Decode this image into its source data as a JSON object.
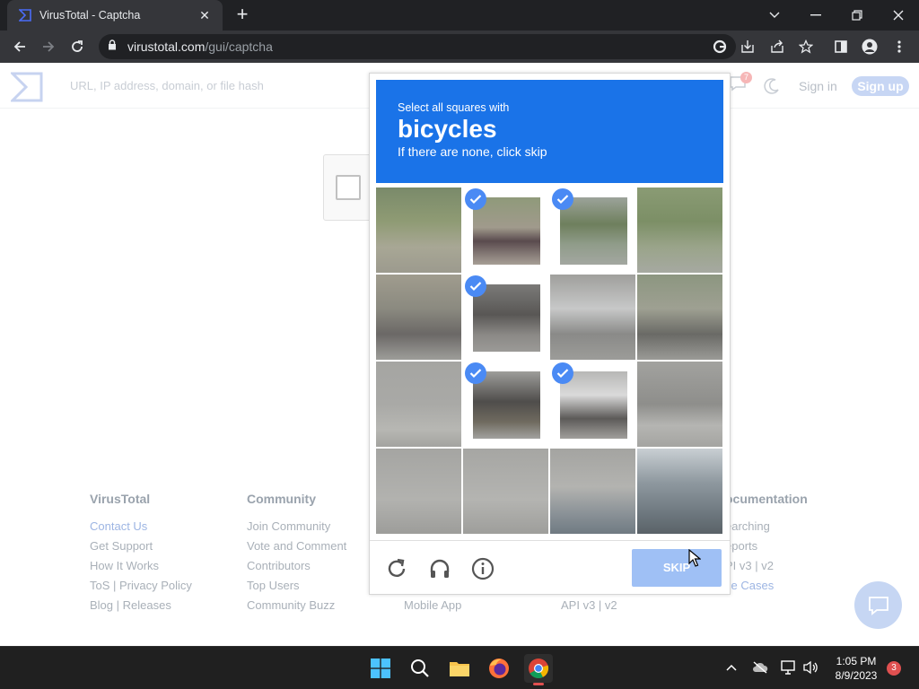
{
  "browser": {
    "tab_title": "VirusTotal - Captcha",
    "url_host": "virustotal.com",
    "url_path": "/gui/captcha"
  },
  "site": {
    "search_placeholder": "URL, IP address, domain, or file hash",
    "notification_count": "7",
    "sign_in": "Sign in",
    "sign_up": "Sign up"
  },
  "captcha": {
    "prompt_line1": "Select all squares with",
    "prompt_object": "bicycles",
    "prompt_line3": "If there are none, click skip",
    "skip_label": "SKIP",
    "tiles_selected": [
      false,
      true,
      true,
      false,
      false,
      true,
      false,
      false,
      false,
      true,
      true,
      false,
      false,
      false,
      false,
      false
    ]
  },
  "footer": {
    "columns": [
      {
        "heading": "VirusTotal",
        "links": [
          "Contact Us",
          "Get Support",
          "How It Works",
          "ToS | Privacy Policy",
          "Blog | Releases"
        ]
      },
      {
        "heading": "Community",
        "links": [
          "Join Community",
          "Vote and Comment",
          "Contributors",
          "Top Users",
          "Community Buzz"
        ]
      },
      {
        "heading": "",
        "links": [
          "Mobile App"
        ]
      },
      {
        "heading": "",
        "links": [
          "API v3 | v2"
        ]
      },
      {
        "heading": "ocumentation",
        "links": [
          "earching",
          "eports",
          "PI v3 | v2",
          "se Cases"
        ]
      }
    ]
  },
  "taskbar": {
    "time": "1:05 PM",
    "date": "8/9/2023",
    "notification_badge": "3"
  },
  "colors": {
    "captcha_blue": "#1a73e8",
    "check_blue": "#4a8af4",
    "skip_disabled": "#9fc0f5"
  }
}
